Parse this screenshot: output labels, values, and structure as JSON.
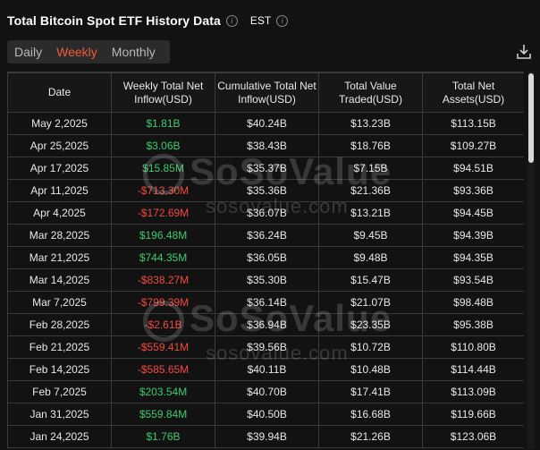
{
  "header": {
    "title": "Total Bitcoin Spot ETF History Data",
    "timezone": "EST"
  },
  "tabs": [
    {
      "label": "Daily",
      "active": false
    },
    {
      "label": "Weekly",
      "active": true
    },
    {
      "label": "Monthly",
      "active": false
    }
  ],
  "table": {
    "columns": [
      "Date",
      "Weekly Total Net Inflow(USD)",
      "Cumulative Total Net Inflow(USD)",
      "Total Value Traded(USD)",
      "Total Net Assets(USD)"
    ],
    "rows": [
      [
        "May 2,2025",
        "$1.81B",
        "$40.24B",
        "$13.23B",
        "$113.15B"
      ],
      [
        "Apr 25,2025",
        "$3.06B",
        "$38.43B",
        "$18.76B",
        "$109.27B"
      ],
      [
        "Apr 17,2025",
        "$15.85M",
        "$35.37B",
        "$7.15B",
        "$94.51B"
      ],
      [
        "Apr 11,2025",
        "-$713.30M",
        "$35.36B",
        "$21.36B",
        "$93.36B"
      ],
      [
        "Apr 4,2025",
        "-$172.69M",
        "$36.07B",
        "$13.21B",
        "$94.45B"
      ],
      [
        "Mar 28,2025",
        "$196.48M",
        "$36.24B",
        "$9.45B",
        "$94.39B"
      ],
      [
        "Mar 21,2025",
        "$744.35M",
        "$36.05B",
        "$9.48B",
        "$94.35B"
      ],
      [
        "Mar 14,2025",
        "-$838.27M",
        "$35.30B",
        "$15.47B",
        "$93.54B"
      ],
      [
        "Mar 7,2025",
        "-$799.39M",
        "$36.14B",
        "$21.07B",
        "$98.48B"
      ],
      [
        "Feb 28,2025",
        "-$2.61B",
        "$36.94B",
        "$23.35B",
        "$95.38B"
      ],
      [
        "Feb 21,2025",
        "-$559.41M",
        "$39.56B",
        "$10.72B",
        "$110.80B"
      ],
      [
        "Feb 14,2025",
        "-$585.65M",
        "$40.11B",
        "$10.48B",
        "$114.44B"
      ],
      [
        "Feb 7,2025",
        "$203.54M",
        "$40.70B",
        "$17.41B",
        "$113.09B"
      ],
      [
        "Jan 31,2025",
        "$559.84M",
        "$40.50B",
        "$16.68B",
        "$119.66B"
      ],
      [
        "Jan 24,2025",
        "$1.76B",
        "$39.94B",
        "$21.26B",
        "$123.06B"
      ]
    ]
  },
  "watermark": {
    "brand": "SoSoValue",
    "url": "sosovalue.com"
  },
  "colors": {
    "accent": "#f25a3a",
    "positive": "#3ecb6c",
    "negative": "#f2493f",
    "background": "#121212"
  },
  "icons": [
    "info-icon",
    "download-icon"
  ]
}
